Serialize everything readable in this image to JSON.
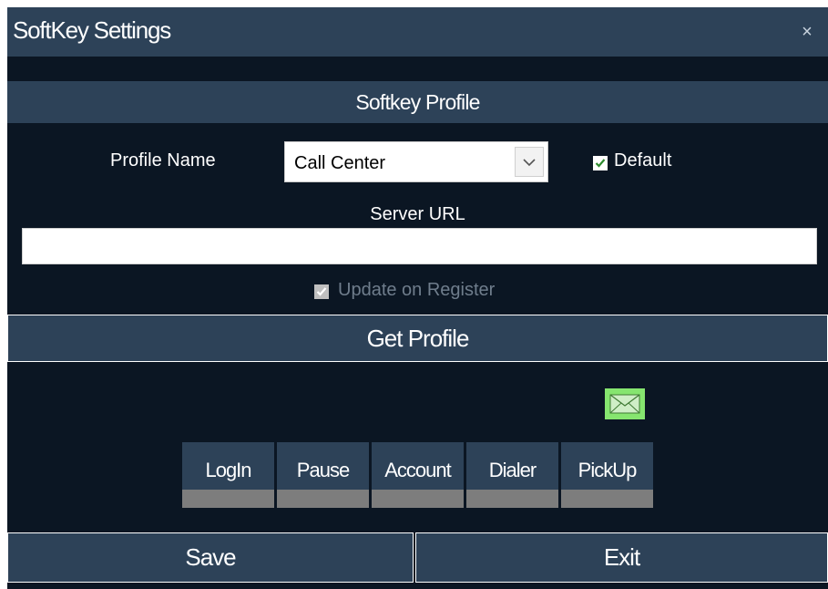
{
  "window": {
    "title": "SoftKey Settings",
    "close_glyph": "×"
  },
  "profile": {
    "header": "Softkey Profile",
    "name_label": "Profile Name",
    "name_value": "Call Center",
    "default_label": "Default",
    "default_checked": true,
    "server_url_label": "Server URL",
    "server_url_value": "",
    "update_on_register_label": "Update on Register",
    "update_on_register_checked": true,
    "update_on_register_enabled": false
  },
  "get_profile_label": "Get Profile",
  "softkeys": [
    {
      "label": "LogIn"
    },
    {
      "label": "Pause"
    },
    {
      "label": "Account"
    },
    {
      "label": "Dialer"
    },
    {
      "label": "PickUp"
    }
  ],
  "footer": {
    "save_label": "Save",
    "exit_label": "Exit"
  },
  "icons": {
    "mail": "envelope-icon",
    "dropdown": "chevron-down-icon",
    "check": "checkmark-icon"
  },
  "colors": {
    "panel_bg": "#0b1623",
    "bar_bg": "#2d4258",
    "mail_icon_bg": "#86e56f",
    "softkey_bar": "#7d7d7d",
    "checkmark_default": "#2e8b2e",
    "disabled_text": "#6f7d8c"
  }
}
